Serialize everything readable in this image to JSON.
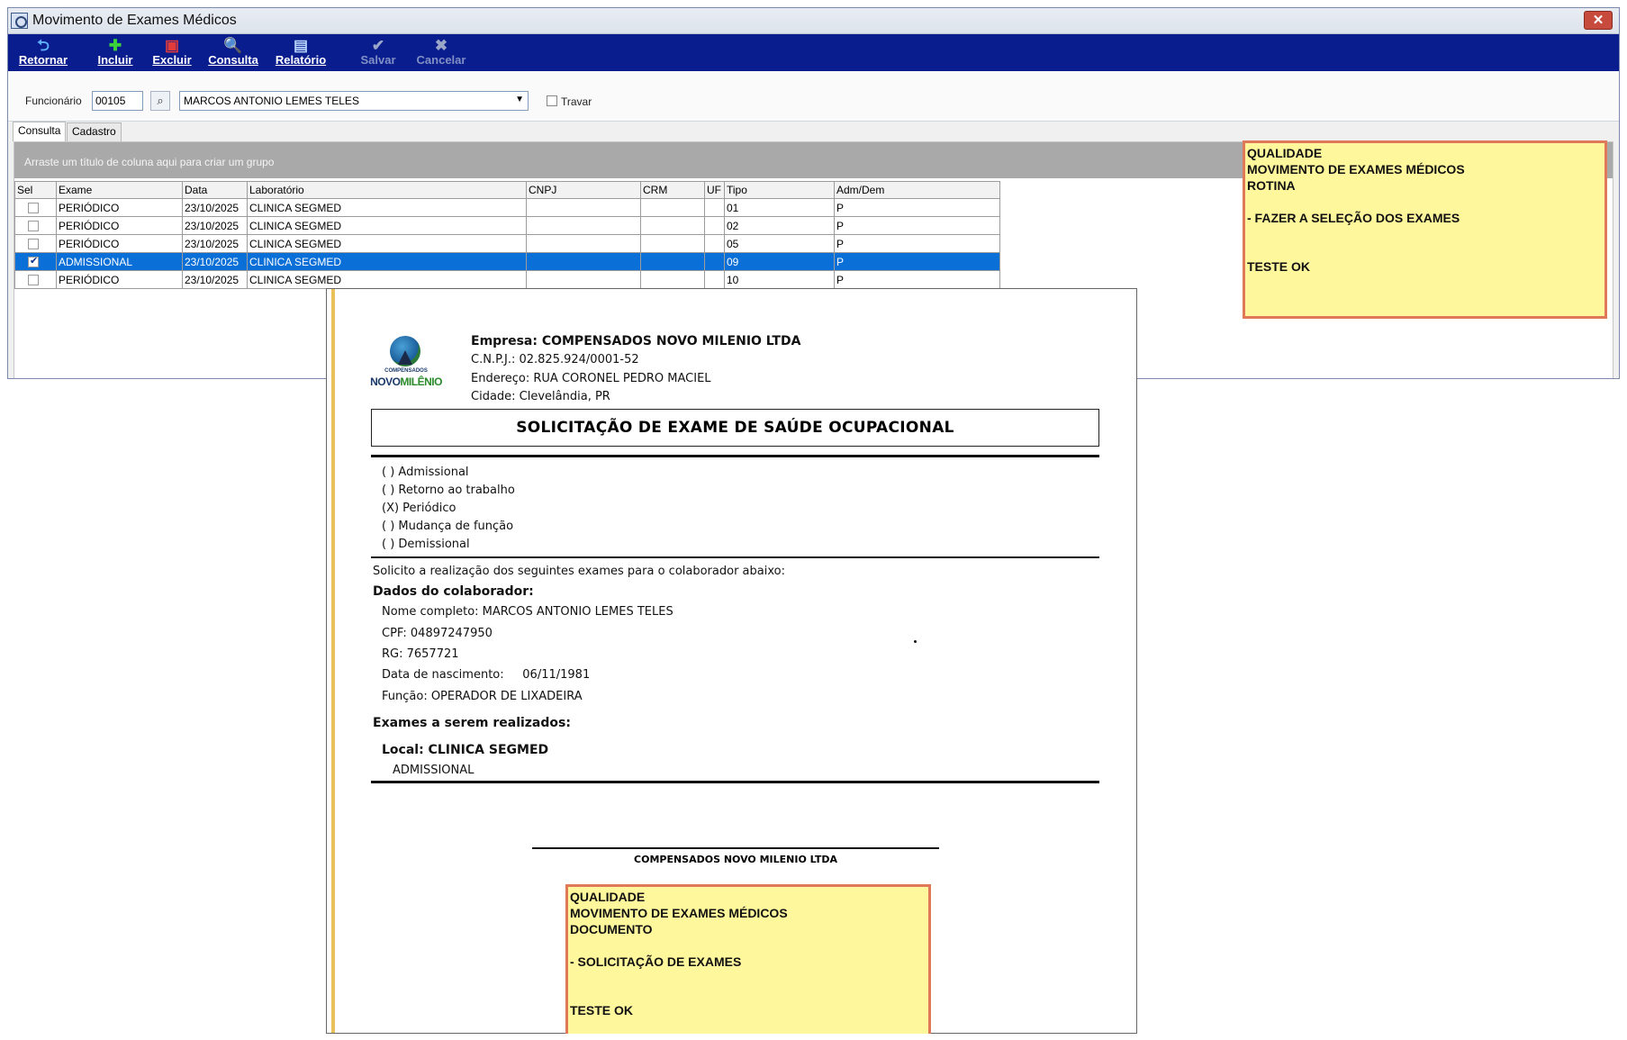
{
  "window": {
    "title": "Movimento de Exames Médicos",
    "close_glyph": "✕"
  },
  "toolbar": {
    "buttons": [
      {
        "label": "Retornar",
        "icon": "undo-arrow-icon",
        "glyph": "⮌",
        "color": "#5fb0ff",
        "enabled": true
      },
      {
        "label": "Incluir",
        "icon": "plus-icon",
        "glyph": "✚",
        "color": "#3bd13b",
        "enabled": true
      },
      {
        "label": "Excluir",
        "icon": "delete-icon",
        "glyph": "▣",
        "color": "#e23b3b",
        "enabled": true
      },
      {
        "label": "Consulta",
        "icon": "magnifier-icon",
        "glyph": "🔍",
        "color": "#8fd0ff",
        "enabled": true
      },
      {
        "label": "Relatório",
        "icon": "printer-icon",
        "glyph": "▤",
        "color": "#b9d6ff",
        "enabled": true
      },
      {
        "label": "Salvar",
        "icon": "check-icon",
        "glyph": "✔",
        "color": "#9aa6c8",
        "enabled": false
      },
      {
        "label": "Cancelar",
        "icon": "cancel-x-icon",
        "glyph": "✖",
        "color": "#9aa6c8",
        "enabled": false
      }
    ]
  },
  "employee": {
    "label": "Funcionário",
    "code": "00105",
    "name": "MARCOS ANTONIO LEMES TELES",
    "lock_label": "Travar",
    "lock_checked": false
  },
  "tabs": [
    {
      "label": "Consulta",
      "active": true
    },
    {
      "label": "Cadastro",
      "active": false
    }
  ],
  "grid": {
    "group_hint": "Arraste um título de coluna aqui para criar um grupo",
    "columns": [
      "Sel",
      "Exame",
      "Data",
      "Laboratório",
      "CNPJ",
      "CRM",
      "UF",
      "Tipo",
      "Adm/Dem"
    ],
    "rows": [
      {
        "sel": false,
        "exame": "PERIÓDICO",
        "data": "23/10/2025",
        "laboratorio": "CLINICA SEGMED",
        "cnpj": "",
        "crm": "",
        "uf": "",
        "tipo": "01",
        "admdem": "P"
      },
      {
        "sel": false,
        "exame": "PERIÓDICO",
        "data": "23/10/2025",
        "laboratorio": "CLINICA SEGMED",
        "cnpj": "",
        "crm": "",
        "uf": "",
        "tipo": "02",
        "admdem": "P"
      },
      {
        "sel": false,
        "exame": "PERIÓDICO",
        "data": "23/10/2025",
        "laboratorio": "CLINICA SEGMED",
        "cnpj": "",
        "crm": "",
        "uf": "",
        "tipo": "05",
        "admdem": "P"
      },
      {
        "sel": true,
        "exame": "ADMISSIONAL",
        "data": "23/10/2025",
        "laboratorio": "CLINICA SEGMED",
        "cnpj": "",
        "crm": "",
        "uf": "",
        "tipo": "09",
        "admdem": "P"
      },
      {
        "sel": false,
        "exame": "PERIÓDICO",
        "data": "23/10/2025",
        "laboratorio": "CLINICA SEGMED",
        "cnpj": "",
        "crm": "",
        "uf": "",
        "tipo": "10",
        "admdem": "P"
      }
    ]
  },
  "note_top": {
    "lines": [
      "QUALIDADE",
      "MOVIMENTO DE EXAMES MÉDICOS",
      "ROTINA",
      "",
      "- FAZER A SELEÇÃO DOS EXAMES",
      "",
      "",
      "TESTE OK"
    ]
  },
  "document": {
    "logo_small": "COMPENSADOS",
    "logo_main_a": "NOVO",
    "logo_main_b": "MILÊNIO",
    "company": "Empresa: COMPENSADOS NOVO MILENIO LTDA",
    "cnpj": "C.N.P.J.: 02.825.924/0001-52",
    "address": "Endereço: RUA CORONEL PEDRO MACIEL",
    "city": "Cidade: Clevelândia, PR",
    "title": "SOLICITAÇÃO DE EXAME DE SAÚDE OCUPACIONAL",
    "options": [
      "( ) Admissional",
      "( ) Retorno ao trabalho",
      "(X) Periódico",
      "( ) Mudança de função",
      "( ) Demissional"
    ],
    "request_text": "Solicito a realização dos seguintes exames para o colaborador abaixo:",
    "collab_header": "Dados do colaborador:",
    "full_name": "Nome completo: MARCOS ANTONIO LEMES TELES",
    "cpf": "CPF: 04897247950",
    "rg": "RG: 7657721",
    "birth": "Data de nascimento:     06/11/1981",
    "role": "Função: OPERADOR DE LIXADEIRA",
    "exams_header": "Exames a serem realizados:",
    "local": "Local: CLINICA SEGMED",
    "exam_item": "ADMISSIONAL",
    "signature": "COMPENSADOS NOVO MILENIO LTDA"
  },
  "note_bottom": {
    "lines": [
      "QUALIDADE",
      "MOVIMENTO DE EXAMES MÉDICOS",
      "DOCUMENTO",
      "",
      "- SOLICITAÇÃO DE EXAMES",
      "",
      "",
      "TESTE OK"
    ]
  }
}
